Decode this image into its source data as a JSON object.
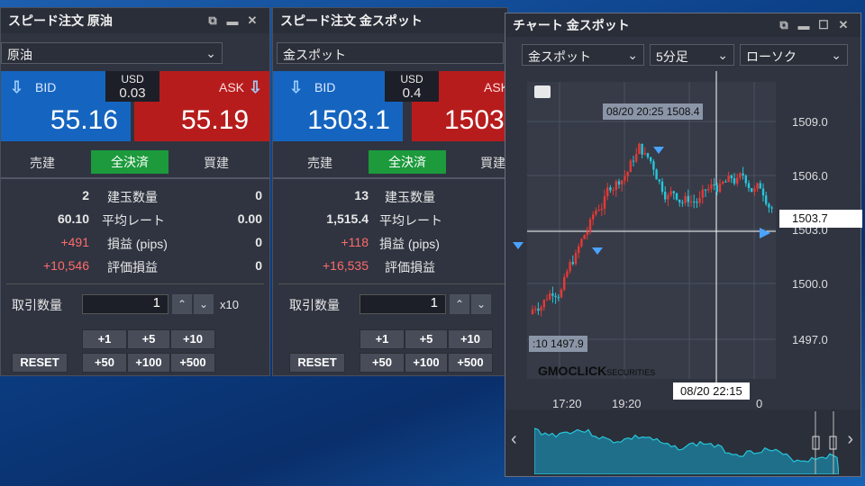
{
  "panel1": {
    "title": "スピード注文 原油",
    "product": "原油",
    "usd_label": "USD",
    "spread": "0.03",
    "bid_label": "BID",
    "ask_label": "ASK",
    "bid": "55.16",
    "ask": "55.19",
    "tab_sell": "売建",
    "tab_close": "全決済",
    "tab_buy": "買建",
    "rows": [
      {
        "left": "2",
        "label": "建玉数量",
        "right": "0"
      },
      {
        "left": "60.10",
        "label": "平均レート",
        "right": "0.00"
      },
      {
        "left": "+491",
        "label": "損益 (pips)",
        "right": "0"
      },
      {
        "left": "+10,546",
        "label": "評価損益",
        "right": "0"
      }
    ],
    "qty_label": "取引数量",
    "qty": "1",
    "multiplier": "x10",
    "btns": [
      "+1",
      "+5",
      "+10",
      "+50",
      "+100",
      "+500"
    ],
    "reset": "RESET"
  },
  "panel2": {
    "title": "スピード注文 金スポット",
    "product": "金スポット",
    "usd_label": "USD",
    "spread": "0.4",
    "bid_label": "BID",
    "ask_label": "ASK",
    "bid": "1503.1",
    "ask": "1503",
    "tab_sell": "売建",
    "tab_close": "全決済",
    "tab_buy": "買建",
    "rows": [
      {
        "left": "13",
        "label": "建玉数量"
      },
      {
        "left": "1,515.4",
        "label": "平均レート"
      },
      {
        "left": "+118",
        "label": "損益 (pips)"
      },
      {
        "left": "+16,535",
        "label": "評価損益"
      }
    ],
    "qty_label": "取引数量",
    "qty": "1",
    "btns": [
      "+1",
      "+5",
      "+10",
      "+50",
      "+100",
      "+500"
    ],
    "reset": "RESET"
  },
  "chart": {
    "title": "チャート 金スポット",
    "product": "金スポット",
    "interval": "5分足",
    "type": "ローソク",
    "y_ticks": [
      "1509.0",
      "1506.0",
      "1503.0",
      "1500.0",
      "1497.0"
    ],
    "x_ticks": [
      "17:20",
      "19:20",
      "0"
    ],
    "current_price": "1503.7",
    "high_label": "08/20 20:25 1508.4",
    "low_label": ":10 1497.9",
    "crosshair_time": "08/20 22:15",
    "watermark": "GMOCLICK",
    "watermark_sub": "SECURITIES",
    "nav_prev": "‹",
    "nav_next": "›"
  },
  "colors": {
    "bid": "#1565c0",
    "ask": "#b71c1c",
    "active_tab": "#1c9a3c",
    "up": "#e53935",
    "down": "#26c6da"
  }
}
